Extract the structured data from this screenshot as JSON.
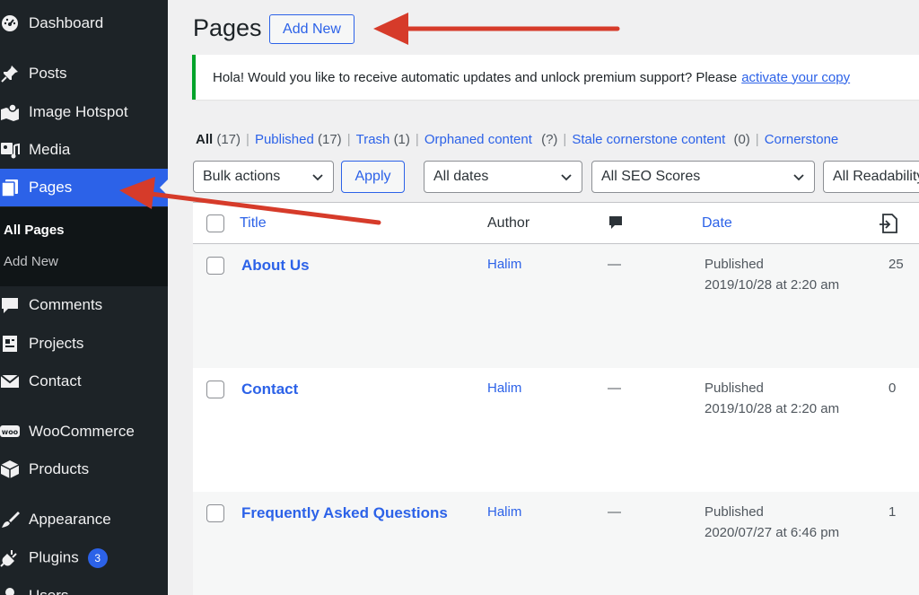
{
  "sidebar": {
    "items": [
      {
        "label": "Dashboard",
        "icon": "dashboard-icon"
      },
      {
        "label": "Posts",
        "icon": "pin-icon"
      },
      {
        "label": "Image Hotspot",
        "icon": "map-icon"
      },
      {
        "label": "Media",
        "icon": "media-icon"
      },
      {
        "label": "Pages",
        "icon": "pages-icon"
      },
      {
        "label": "Comments",
        "icon": "comment-icon"
      },
      {
        "label": "Projects",
        "icon": "portfolio-icon"
      },
      {
        "label": "Contact",
        "icon": "envelope-icon"
      },
      {
        "label": "WooCommerce",
        "icon": "woo-icon"
      },
      {
        "label": "Products",
        "icon": "box-icon"
      },
      {
        "label": "Appearance",
        "icon": "brush-icon"
      },
      {
        "label": "Plugins",
        "icon": "plugin-icon",
        "badge": "3"
      },
      {
        "label": "Users",
        "icon": "users-icon"
      }
    ],
    "submenu": [
      "All Pages",
      "Add New"
    ]
  },
  "header": {
    "title": "Pages",
    "add_new": "Add New"
  },
  "notice": {
    "text": "Hola! Would you like to receive automatic updates and unlock premium support? Please",
    "link": "activate your copy"
  },
  "filters": {
    "all_label": "All",
    "all_count": "(17)",
    "published_label": "Published",
    "published_count": "(17)",
    "trash_label": "Trash",
    "trash_count": "(1)",
    "orphaned_label": "Orphaned content",
    "orphaned_count": "(?)",
    "stale_label": "Stale cornerstone content",
    "stale_count": "(0)",
    "cornerstone_label": "Cornerstone"
  },
  "controls": {
    "bulk_actions": "Bulk actions",
    "apply": "Apply",
    "dates": "All dates",
    "seo": "All SEO Scores",
    "readability": "All Readability Scores"
  },
  "table": {
    "columns": {
      "title": "Title",
      "author": "Author",
      "date": "Date"
    },
    "rows": [
      {
        "title": "About Us",
        "author": "Halim",
        "comments": "—",
        "status": "Published",
        "date": "2019/10/28 at 2:20 am",
        "links": "25"
      },
      {
        "title": "Contact",
        "author": "Halim",
        "comments": "—",
        "status": "Published",
        "date": "2019/10/28 at 2:20 am",
        "links": "0"
      },
      {
        "title": "Frequently Asked Questions",
        "author": "Halim",
        "comments": "—",
        "status": "Published",
        "date": "2020/07/27 at 6:46 pm",
        "links": "1"
      }
    ]
  },
  "colors": {
    "sidebar_bg": "#1d2327",
    "accent": "#2c62e8",
    "annotation_arrow": "#d63b2a",
    "notice_border": "#00a32a"
  }
}
